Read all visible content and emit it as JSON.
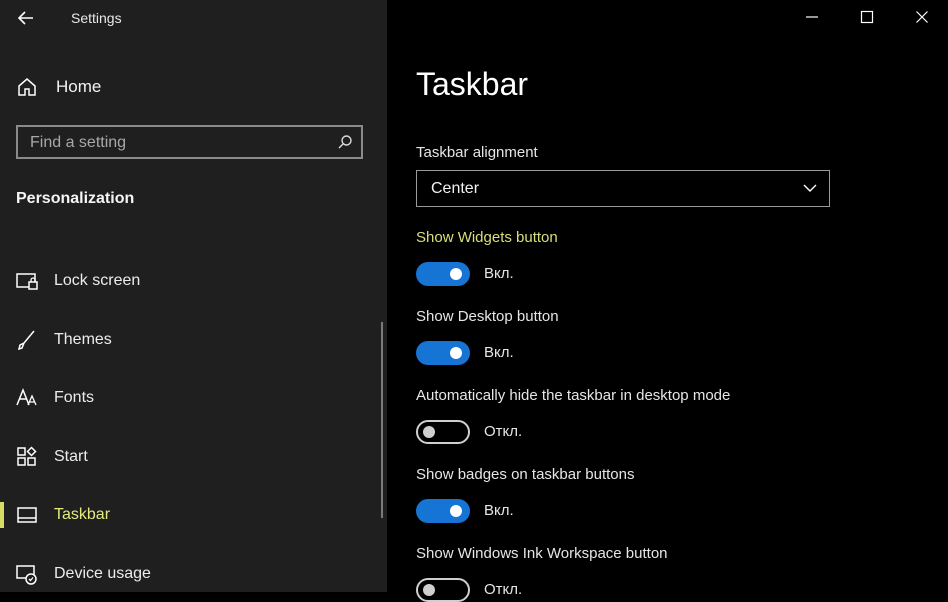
{
  "window": {
    "title": "Settings",
    "controls": [
      "minimize",
      "maximize",
      "close"
    ]
  },
  "sidebar": {
    "home_label": "Home",
    "search_placeholder": "Find a setting",
    "section_title": "Personalization",
    "items": [
      {
        "label": "Lock screen",
        "icon": "lock-screen-icon"
      },
      {
        "label": "Themes",
        "icon": "brush-icon"
      },
      {
        "label": "Fonts",
        "icon": "fonts-icon"
      },
      {
        "label": "Start",
        "icon": "start-icon"
      },
      {
        "label": "Taskbar",
        "icon": "taskbar-icon",
        "selected": true
      },
      {
        "label": "Device usage",
        "icon": "device-usage-icon"
      }
    ]
  },
  "main": {
    "title": "Taskbar",
    "alignment": {
      "label": "Taskbar alignment",
      "value": "Center"
    },
    "settings": [
      {
        "label": "Show Widgets button",
        "state": "Вкл.",
        "on": true
      },
      {
        "label": "Show Desktop button",
        "state": "Вкл.",
        "on": true
      },
      {
        "label": "Automatically hide the taskbar in desktop mode",
        "state": "Откл.",
        "on": false
      },
      {
        "label": "Show badges on taskbar buttons",
        "state": "Вкл.",
        "on": true
      },
      {
        "label": "Show Windows Ink Workspace button",
        "state": "Откл.",
        "on": false
      }
    ]
  },
  "colors": {
    "accent_toggle": "#1674d4",
    "selected_text": "#e4ea80",
    "sidebar_bg": "#1f1f1f",
    "main_bg": "#000000"
  }
}
